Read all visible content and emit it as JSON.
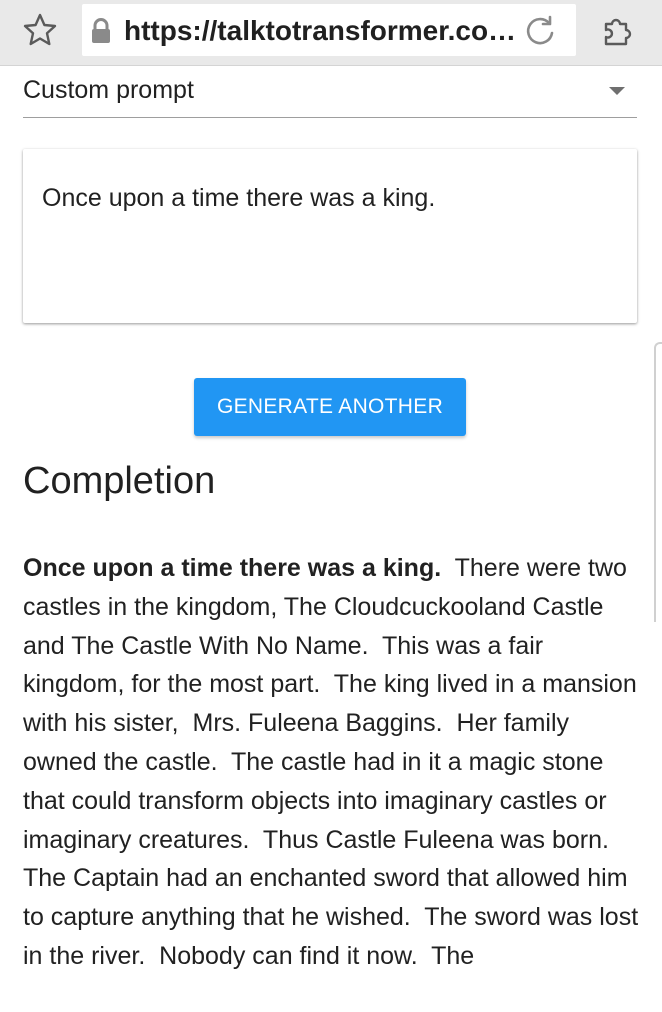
{
  "browser": {
    "url": "https://talktotransformer.co…",
    "icons": {
      "star": "star-icon",
      "lock": "lock-icon",
      "reload": "reload-icon",
      "extension": "extension-icon"
    }
  },
  "prompt_select": {
    "selected": "Custom prompt"
  },
  "prompt_input": {
    "value": "Once upon a time there was a king."
  },
  "actions": {
    "generate_label": "GENERATE ANOTHER"
  },
  "completion": {
    "heading": "Completion",
    "prompt_bold": "Once upon a time there was a king.",
    "paragraph1": "  There were two castles in the kingdom, The Cloudcuckooland Castle and The Castle With No Name.  This was a fair kingdom, for the most part.  The king lived in a mansion with his sister,  Mrs. Fuleena Baggins.  Her family owned the castle.  The castle had in it a magic stone that could transform objects into imaginary castles or imaginary creatures.  Thus Castle Fuleena was born.",
    "paragraph2": "The Captain had an enchanted sword that allowed him to capture anything that he wished.  The sword was lost in the river.  Nobody can find it now.  The"
  },
  "colors": {
    "button_bg": "#2196f3",
    "browser_bar": "#e9e9e9"
  }
}
